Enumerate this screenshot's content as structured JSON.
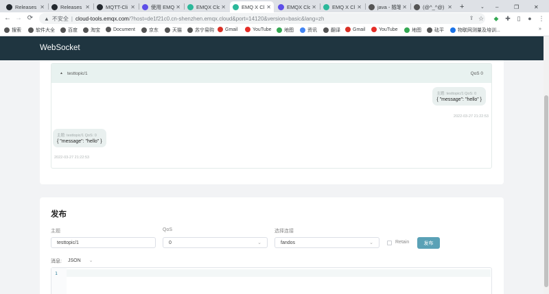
{
  "browser": {
    "tabs": [
      {
        "label": "Releases ·",
        "icon": "github-icon",
        "color": "#24292f"
      },
      {
        "label": "Releases ·",
        "icon": "github-icon",
        "color": "#24292f"
      },
      {
        "label": "MQTT-Cli",
        "icon": "github-icon",
        "color": "#24292f"
      },
      {
        "label": "使用 EMQ",
        "icon": "emqx-doc-icon",
        "color": "#5d4ee8"
      },
      {
        "label": "EMQX Clo",
        "icon": "emqx-cloud-icon",
        "color": "#2cb89a"
      },
      {
        "label": "EMQ X Cl",
        "icon": "emqx-cloud-icon",
        "color": "#2cb89a"
      },
      {
        "label": "EMQX Clo",
        "icon": "emqx-doc-icon",
        "color": "#5d4ee8"
      },
      {
        "label": "EMQ X Cl",
        "icon": "emqx-cloud-icon",
        "color": "#2cb89a"
      },
      {
        "label": "java - 随笔",
        "icon": "blog-icon",
        "color": "#555"
      },
      {
        "label": "(@^_^@) Hi",
        "icon": "blog-icon",
        "color": "#555"
      }
    ],
    "new_tab": "+",
    "url": {
      "insecure_label": "不安全",
      "host": "cloud-tools.emqx.com",
      "path": "/?host=de1f21c0.cn-shenzhen.emqx.cloud&port=14120&version=basic&lang=zh"
    },
    "bookmarks": [
      {
        "label": "搜索",
        "color": "#555"
      },
      {
        "label": "软件大全",
        "color": "#555"
      },
      {
        "label": "百度",
        "color": "#555"
      },
      {
        "label": "淘宝",
        "color": "#555"
      },
      {
        "label": "Document",
        "color": "#555"
      },
      {
        "label": "京东",
        "color": "#555"
      },
      {
        "label": "天猫",
        "color": "#555"
      },
      {
        "label": "苏宁易购",
        "color": "#555"
      },
      {
        "label": "Gmail",
        "color": "#d93025"
      },
      {
        "label": "YouTube",
        "color": "#e52d27"
      },
      {
        "label": "地图",
        "color": "#34a853"
      },
      {
        "label": "资讯",
        "color": "#4285f4"
      },
      {
        "label": "翻译",
        "color": "#555"
      },
      {
        "label": "Gmail",
        "color": "#d93025"
      },
      {
        "label": "YouTube",
        "color": "#e52d27"
      },
      {
        "label": "地图",
        "color": "#34a853"
      },
      {
        "label": "砝平",
        "color": "#555"
      },
      {
        "label": "物联网测量及培训...",
        "color": "#1a73e8"
      }
    ]
  },
  "app": {
    "title": "WebSocket"
  },
  "messages": {
    "topic": "testtopic/1",
    "qos": "QoS 0",
    "received": {
      "meta": "主题: testtopic/1 QoS: 0",
      "text": "{ \"message\": \"hello\" }",
      "time": "2022-03-27 21:22:53"
    },
    "sent": {
      "meta": "主题: testtopic/1 QoS: 0",
      "text": "{ \"message\": \"hello\" }",
      "time": "2022-03-27 21:22:53"
    }
  },
  "publish": {
    "title": "发布",
    "topic_label": "主题",
    "topic_value": "testtopic/1",
    "qos_label": "QoS",
    "qos_value": "0",
    "connection_label": "选择连接",
    "connection_value": "fandos",
    "retain_label": "Retain",
    "publish_button": "发布",
    "payload_label": "消息:",
    "payload_format": "JSON",
    "editor_line": "1"
  }
}
